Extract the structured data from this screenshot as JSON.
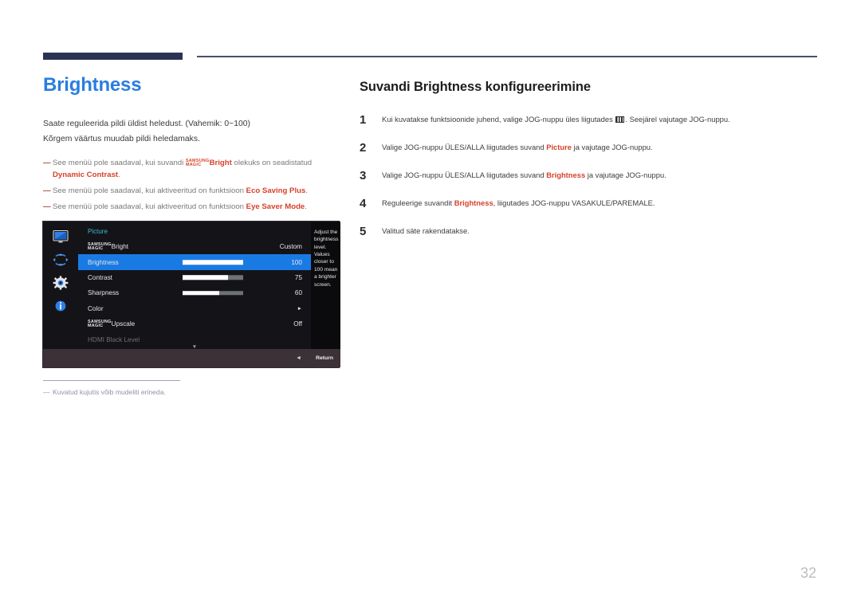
{
  "page": {
    "number": "32"
  },
  "left": {
    "title": "Brightness",
    "body": [
      "Saate reguleerida pildi üldist heledust. (Vahemik: 0~100)",
      "Kõrgem väärtus muudab pildi heledamaks."
    ],
    "notes": [
      {
        "dash": "―",
        "pre": "See menüü pole saadaval, kui suvandi ",
        "magic_top": "SAMSUNG",
        "magic_bottom": "MAGIC",
        "magic_suffix": "Bright",
        "mid": " olekuks on seadistatud ",
        "highlight": "Dynamic Contrast",
        "post": "."
      },
      {
        "dash": "―",
        "pre": "See menüü pole saadaval, kui aktiveeritud on funktsioon ",
        "highlight": "Eco Saving Plus",
        "post": "."
      },
      {
        "dash": "―",
        "pre": "See menüü pole saadaval, kui aktiveeritud on funktsioon ",
        "highlight": "Eye Saver Mode",
        "post": "."
      }
    ],
    "image_note": {
      "dash": "―",
      "text": "Kuvatud kujutis võib mudeliti erineda."
    }
  },
  "osd": {
    "title": "Picture",
    "description": "Adjust the brightness level. Values closer to 100 mean a brighter screen.",
    "return_label": "Return",
    "sidebar_icons": [
      "display-icon",
      "move-arrows-icon",
      "gear-icon",
      "info-icon"
    ],
    "rows": [
      {
        "label_top": "SAMSUNG",
        "label_bottom": "MAGIC",
        "label_suffix": "Bright",
        "value": "Custom",
        "slider": null,
        "selected": false,
        "dim": false
      },
      {
        "label": "Brightness",
        "value": "100",
        "slider": 100,
        "selected": true,
        "dim": false
      },
      {
        "label": "Contrast",
        "value": "75",
        "slider": 75,
        "selected": false,
        "dim": false
      },
      {
        "label": "Sharpness",
        "value": "60",
        "slider": 60,
        "selected": false,
        "dim": false
      },
      {
        "label": "Color",
        "value": "►",
        "slider": null,
        "selected": false,
        "dim": false
      },
      {
        "label_top": "SAMSUNG",
        "label_bottom": "MAGIC",
        "label_suffix": "Upscale",
        "value": "Off",
        "slider": null,
        "selected": false,
        "dim": false
      },
      {
        "label": "HDMI Black Level",
        "value": "",
        "slider": null,
        "selected": false,
        "dim": true
      }
    ],
    "scroll_down_glyph": "▼",
    "back_glyph": "◄"
  },
  "right": {
    "heading": "Suvandi Brightness konfigureerimine",
    "steps": [
      {
        "num": "1",
        "pre": "Kui kuvatakse funktsioonide juhend, valige JOG-nuppu üles liigutades ",
        "glyph": "menu-icon",
        "post": ". Seejärel vajutage JOG-nuppu."
      },
      {
        "num": "2",
        "pre": "Valige JOG-nuppu ÜLES/ALLA liigutades suvand ",
        "highlight": "Picture",
        "post": " ja vajutage JOG-nuppu."
      },
      {
        "num": "3",
        "pre": "Valige JOG-nuppu ÜLES/ALLA liigutades suvand ",
        "highlight": "Brightness",
        "post": " ja vajutage JOG-nuppu."
      },
      {
        "num": "4",
        "pre": "Reguleerige suvandit ",
        "highlight": "Brightness",
        "post": ", liigutades JOG-nuppu VASAKULE/PAREMALE."
      },
      {
        "num": "5",
        "pre": "Valitud säte rakendatakse.",
        "highlight": "",
        "post": ""
      }
    ]
  },
  "colors": {
    "accent_blue": "#2a7de1",
    "accent_red": "#d6412b",
    "rule_navy": "#2b3354",
    "osd_select": "#1a7ae4",
    "note_gray": "#8e91ad"
  }
}
